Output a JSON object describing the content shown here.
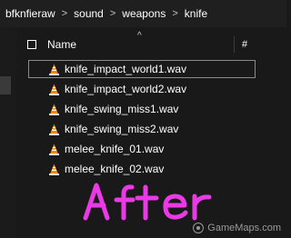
{
  "breadcrumb": {
    "items": [
      "bfknfieraw",
      "sound",
      "weapons",
      "knife"
    ],
    "separator": ">"
  },
  "header": {
    "name_label": "Name",
    "extra_label": "#",
    "sort_indicator": "^"
  },
  "files": [
    {
      "name": "knife_impact_world1.wav",
      "icon": "vlc-cone-icon"
    },
    {
      "name": "knife_impact_world2.wav",
      "icon": "vlc-cone-icon"
    },
    {
      "name": "knife_swing_miss1.wav",
      "icon": "vlc-cone-icon"
    },
    {
      "name": "knife_swing_miss2.wav",
      "icon": "vlc-cone-icon"
    },
    {
      "name": "melee_knife_01.wav",
      "icon": "vlc-cone-icon"
    },
    {
      "name": "melee_knife_02.wav",
      "icon": "vlc-cone-icon"
    }
  ],
  "overlay": {
    "handwritten_text": "After",
    "handwritten_color": "#e93ae6",
    "site_watermark": "GameMaps.com"
  },
  "colors": {
    "background": "#191919",
    "breadcrumb_bar": "#1f1f1f",
    "vlc_orange": "#f08a00"
  }
}
